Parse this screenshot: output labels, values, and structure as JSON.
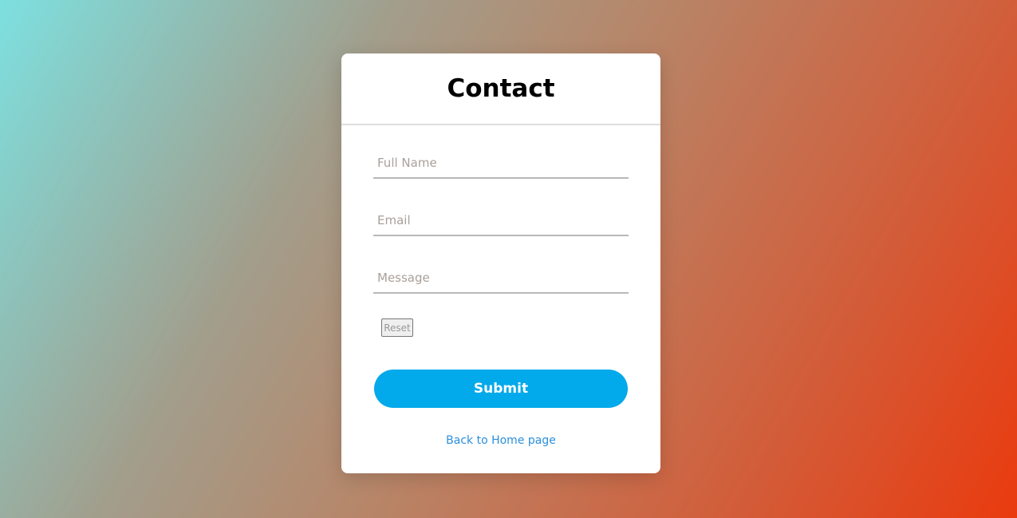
{
  "form": {
    "title": "Contact",
    "full_name_placeholder": "Full Name",
    "email_placeholder": "Email",
    "message_placeholder": "Message",
    "reset_label": "Reset",
    "submit_label": "Submit",
    "back_link": "Back to Home page"
  },
  "colors": {
    "accent": "#02a9eb",
    "link": "#2b8fdc"
  }
}
